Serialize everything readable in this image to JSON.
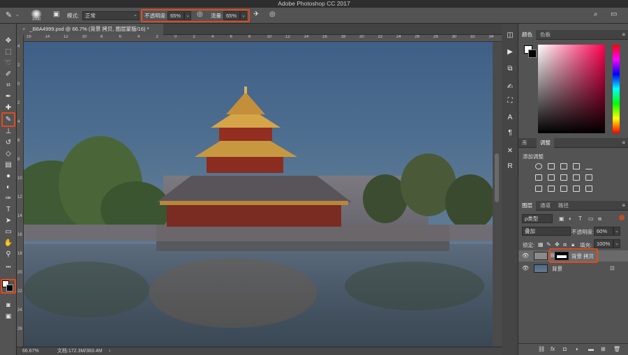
{
  "window": {
    "title": "Adobe Photoshop CC 2017"
  },
  "options_bar": {
    "brush_size": "1500",
    "mode_label": "模式:",
    "mode_value": "正常",
    "opacity_label": "不透明度:",
    "opacity_value": "65%",
    "flow_label": "流量:",
    "flow_value": "65%"
  },
  "document": {
    "tab_title": "_B8A4999.psd @ 66.7% (背景 拷贝, 图层蒙版/16) *",
    "zoom": "66.67%",
    "doc_size": "文档:172.3M/383.4M"
  },
  "ruler_top": [
    "16",
    "14",
    "12",
    "10",
    "8",
    "6",
    "4",
    "2",
    "0",
    "2",
    "4",
    "6",
    "8",
    "10",
    "12",
    "14",
    "16",
    "18",
    "20",
    "22",
    "24",
    "26",
    "28",
    "30",
    "32",
    "34"
  ],
  "ruler_left": [
    "4",
    "2",
    "0",
    "2",
    "4",
    "6",
    "8",
    "10",
    "12",
    "14",
    "16",
    "18",
    "20",
    "22",
    "24",
    "26"
  ],
  "panels": {
    "color_tabs": [
      "颜色",
      "色板"
    ],
    "adjust_tabs": [
      "库",
      "调整"
    ],
    "adjust_title": "添加调整",
    "layers_tabs": [
      "图层",
      "通道",
      "路径"
    ],
    "layer_filter": "ρ类型",
    "blend_mode": "叠加",
    "opacity_label": "不透明度:",
    "opacity_value": "60%",
    "lock_label": "锁定:",
    "fill_label": "填充:",
    "fill_value": "100%",
    "layers": [
      {
        "name": "背景 拷贝"
      },
      {
        "name": "背景"
      }
    ]
  },
  "colors": {
    "highlight": "#e04b1f",
    "panel_bg": "#535353",
    "dark_bg": "#3a3a3a"
  },
  "tools": [
    "move-icon",
    "marquee-icon",
    "lasso-icon",
    "quick-select-icon",
    "crop-icon",
    "eyedropper-icon",
    "healing-icon",
    "brush-icon",
    "stamp-icon",
    "history-brush-icon",
    "eraser-icon",
    "gradient-icon",
    "blur-icon",
    "dodge-icon",
    "pen-icon",
    "type-icon",
    "path-select-icon",
    "shape-icon",
    "hand-icon",
    "zoom-icon"
  ]
}
